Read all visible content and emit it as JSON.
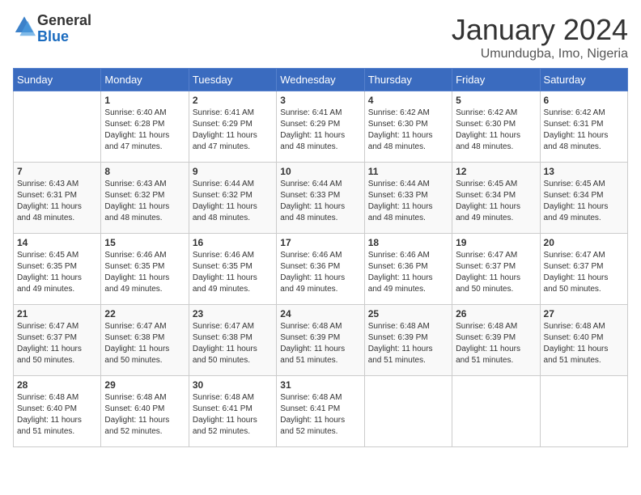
{
  "header": {
    "logo_line1": "General",
    "logo_line2": "Blue",
    "title": "January 2024",
    "subtitle": "Umundugba, Imo, Nigeria"
  },
  "weekdays": [
    "Sunday",
    "Monday",
    "Tuesday",
    "Wednesday",
    "Thursday",
    "Friday",
    "Saturday"
  ],
  "weeks": [
    [
      {
        "day": "",
        "info": ""
      },
      {
        "day": "1",
        "info": "Sunrise: 6:40 AM\nSunset: 6:28 PM\nDaylight: 11 hours\nand 47 minutes."
      },
      {
        "day": "2",
        "info": "Sunrise: 6:41 AM\nSunset: 6:29 PM\nDaylight: 11 hours\nand 47 minutes."
      },
      {
        "day": "3",
        "info": "Sunrise: 6:41 AM\nSunset: 6:29 PM\nDaylight: 11 hours\nand 48 minutes."
      },
      {
        "day": "4",
        "info": "Sunrise: 6:42 AM\nSunset: 6:30 PM\nDaylight: 11 hours\nand 48 minutes."
      },
      {
        "day": "5",
        "info": "Sunrise: 6:42 AM\nSunset: 6:30 PM\nDaylight: 11 hours\nand 48 minutes."
      },
      {
        "day": "6",
        "info": "Sunrise: 6:42 AM\nSunset: 6:31 PM\nDaylight: 11 hours\nand 48 minutes."
      }
    ],
    [
      {
        "day": "7",
        "info": "Sunrise: 6:43 AM\nSunset: 6:31 PM\nDaylight: 11 hours\nand 48 minutes."
      },
      {
        "day": "8",
        "info": "Sunrise: 6:43 AM\nSunset: 6:32 PM\nDaylight: 11 hours\nand 48 minutes."
      },
      {
        "day": "9",
        "info": "Sunrise: 6:44 AM\nSunset: 6:32 PM\nDaylight: 11 hours\nand 48 minutes."
      },
      {
        "day": "10",
        "info": "Sunrise: 6:44 AM\nSunset: 6:33 PM\nDaylight: 11 hours\nand 48 minutes."
      },
      {
        "day": "11",
        "info": "Sunrise: 6:44 AM\nSunset: 6:33 PM\nDaylight: 11 hours\nand 48 minutes."
      },
      {
        "day": "12",
        "info": "Sunrise: 6:45 AM\nSunset: 6:34 PM\nDaylight: 11 hours\nand 49 minutes."
      },
      {
        "day": "13",
        "info": "Sunrise: 6:45 AM\nSunset: 6:34 PM\nDaylight: 11 hours\nand 49 minutes."
      }
    ],
    [
      {
        "day": "14",
        "info": "Sunrise: 6:45 AM\nSunset: 6:35 PM\nDaylight: 11 hours\nand 49 minutes."
      },
      {
        "day": "15",
        "info": "Sunrise: 6:46 AM\nSunset: 6:35 PM\nDaylight: 11 hours\nand 49 minutes."
      },
      {
        "day": "16",
        "info": "Sunrise: 6:46 AM\nSunset: 6:35 PM\nDaylight: 11 hours\nand 49 minutes."
      },
      {
        "day": "17",
        "info": "Sunrise: 6:46 AM\nSunset: 6:36 PM\nDaylight: 11 hours\nand 49 minutes."
      },
      {
        "day": "18",
        "info": "Sunrise: 6:46 AM\nSunset: 6:36 PM\nDaylight: 11 hours\nand 49 minutes."
      },
      {
        "day": "19",
        "info": "Sunrise: 6:47 AM\nSunset: 6:37 PM\nDaylight: 11 hours\nand 50 minutes."
      },
      {
        "day": "20",
        "info": "Sunrise: 6:47 AM\nSunset: 6:37 PM\nDaylight: 11 hours\nand 50 minutes."
      }
    ],
    [
      {
        "day": "21",
        "info": "Sunrise: 6:47 AM\nSunset: 6:37 PM\nDaylight: 11 hours\nand 50 minutes."
      },
      {
        "day": "22",
        "info": "Sunrise: 6:47 AM\nSunset: 6:38 PM\nDaylight: 11 hours\nand 50 minutes."
      },
      {
        "day": "23",
        "info": "Sunrise: 6:47 AM\nSunset: 6:38 PM\nDaylight: 11 hours\nand 50 minutes."
      },
      {
        "day": "24",
        "info": "Sunrise: 6:48 AM\nSunset: 6:39 PM\nDaylight: 11 hours\nand 51 minutes."
      },
      {
        "day": "25",
        "info": "Sunrise: 6:48 AM\nSunset: 6:39 PM\nDaylight: 11 hours\nand 51 minutes."
      },
      {
        "day": "26",
        "info": "Sunrise: 6:48 AM\nSunset: 6:39 PM\nDaylight: 11 hours\nand 51 minutes."
      },
      {
        "day": "27",
        "info": "Sunrise: 6:48 AM\nSunset: 6:40 PM\nDaylight: 11 hours\nand 51 minutes."
      }
    ],
    [
      {
        "day": "28",
        "info": "Sunrise: 6:48 AM\nSunset: 6:40 PM\nDaylight: 11 hours\nand 51 minutes."
      },
      {
        "day": "29",
        "info": "Sunrise: 6:48 AM\nSunset: 6:40 PM\nDaylight: 11 hours\nand 52 minutes."
      },
      {
        "day": "30",
        "info": "Sunrise: 6:48 AM\nSunset: 6:41 PM\nDaylight: 11 hours\nand 52 minutes."
      },
      {
        "day": "31",
        "info": "Sunrise: 6:48 AM\nSunset: 6:41 PM\nDaylight: 11 hours\nand 52 minutes."
      },
      {
        "day": "",
        "info": ""
      },
      {
        "day": "",
        "info": ""
      },
      {
        "day": "",
        "info": ""
      }
    ]
  ]
}
